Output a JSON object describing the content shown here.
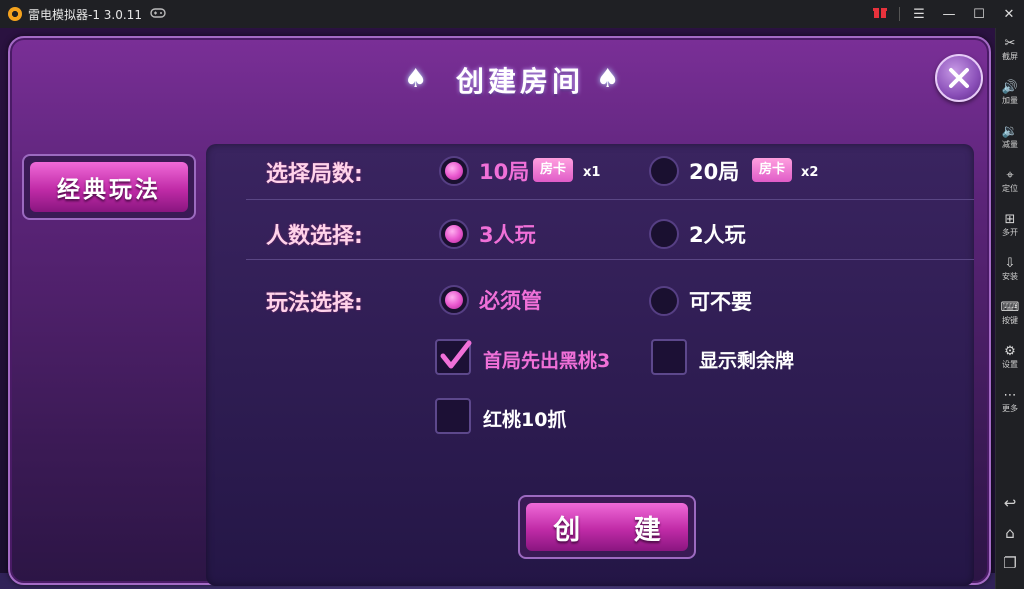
{
  "window": {
    "title": "雷电模拟器-1 3.0.11",
    "controls": [
      "gift-icon",
      "menu-icon",
      "minimize-icon",
      "maximize-icon",
      "close-icon"
    ]
  },
  "sidebar": {
    "items": [
      {
        "label": "截屏",
        "icon": "scissors-icon"
      },
      {
        "label": "加量",
        "icon": "volume-up-icon"
      },
      {
        "label": "减量",
        "icon": "volume-down-icon"
      },
      {
        "label": "定位",
        "icon": "location-icon"
      },
      {
        "label": "多开",
        "icon": "multi-instance-icon"
      },
      {
        "label": "安装",
        "icon": "apk-install-icon"
      },
      {
        "label": "按键",
        "icon": "keyboard-icon"
      },
      {
        "label": "设置",
        "icon": "settings-icon"
      },
      {
        "label": "更多",
        "icon": "more-icon"
      }
    ],
    "nav": [
      "back-icon",
      "home-icon",
      "recent-apps-icon"
    ]
  },
  "dialog": {
    "title": "创建房间",
    "mode_tab": "经典玩法",
    "rows": {
      "rounds": {
        "label": "选择局数:",
        "options": [
          {
            "text": "10局",
            "badge": "房卡",
            "multiplier": "x1",
            "selected": true
          },
          {
            "text": "20局",
            "badge": "房卡",
            "multiplier": "x2",
            "selected": false
          }
        ]
      },
      "players": {
        "label": "人数选择:",
        "options": [
          {
            "text": "3人玩",
            "selected": true
          },
          {
            "text": "2人玩",
            "selected": false
          }
        ]
      },
      "rules": {
        "label": "玩法选择:",
        "options": [
          {
            "text": "必须管",
            "selected": true
          },
          {
            "text": "可不要",
            "selected": false
          }
        ]
      }
    },
    "checkboxes": [
      {
        "text": "首局先出黑桃3",
        "checked": true
      },
      {
        "text": "显示剩余牌",
        "checked": false
      },
      {
        "text": "红桃10抓",
        "checked": false
      }
    ],
    "create_button": "创 建"
  },
  "colors": {
    "accent_pink": "#f070d8",
    "panel_purple": "#5b2478",
    "titlebar": "#1f2024"
  }
}
